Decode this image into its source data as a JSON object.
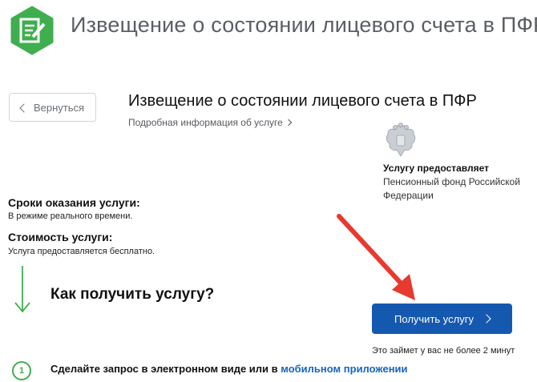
{
  "header": {
    "title": "Извещение о состоянии лицевого счета в ПФР",
    "logo_icon": "document-pencil-icon",
    "accent_color": "#3fae4e"
  },
  "back_button": {
    "label": "Вернуться",
    "icon": "chevron-left-icon"
  },
  "service": {
    "title": "Извещение о состоянии лицевого счета в ПФР",
    "details_link": "Подробная информация об услуге"
  },
  "provider": {
    "emblem_icon": "coat-of-arms-icon",
    "label": "Услугу предоставляет",
    "name": "Пенсионный фонд Российской Федерации"
  },
  "terms": {
    "label": "Сроки оказания услуги:",
    "value": "В режиме реального времени."
  },
  "cost": {
    "label": "Стоимость услуги:",
    "value": "Услуга предоставляется бесплатно."
  },
  "how": {
    "title": "Как получить услугу?"
  },
  "get_service_button": {
    "label": "Получить услугу",
    "color": "#1558b0"
  },
  "time_note": "Это займет у вас не более 2 минут",
  "step": {
    "number": "1",
    "text": "Сделайте запрос в электронном виде или в ",
    "link_text": "мобильном приложении"
  }
}
